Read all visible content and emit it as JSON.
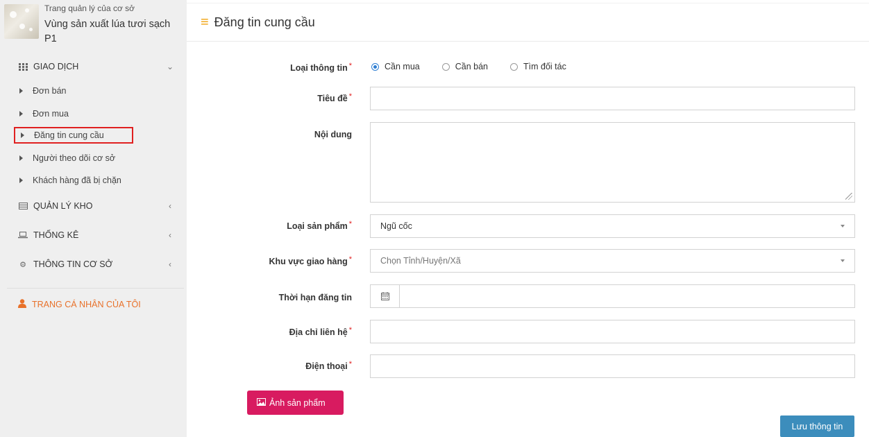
{
  "profile": {
    "subtitle": "Trang quản lý của cơ sở",
    "name": "Vùng sản xuất lúa tươi sạch P1"
  },
  "sidebar": {
    "transactions": {
      "label": "GIAO DỊCH",
      "icon": "grid-icon",
      "items": [
        {
          "label": "Đơn bán"
        },
        {
          "label": "Đơn mua"
        },
        {
          "label": "Đăng tin cung cầu"
        },
        {
          "label": "Người theo dõi cơ sở"
        },
        {
          "label": "Khách hàng đã bị chặn"
        }
      ]
    },
    "warehouse": {
      "label": "QUẢN LÝ KHO",
      "icon": "table-icon"
    },
    "stats": {
      "label": "THỐNG KÊ",
      "icon": "laptop-icon"
    },
    "info": {
      "label": "THÔNG TIN CƠ SỞ",
      "icon": "gears-icon"
    },
    "personal": {
      "label": "TRANG CÁ NHÂN CỦA TÔI",
      "icon": "user-icon",
      "color": "#e8712a"
    }
  },
  "header": {
    "title": "Đăng tin cung cầu",
    "icon": "bars-icon",
    "icon_color": "#f0a20c"
  },
  "form": {
    "info_type": {
      "label": "Loại thông tin",
      "required": "*",
      "options": [
        {
          "label": "Cần mua",
          "selected": true
        },
        {
          "label": "Cần bán",
          "selected": false
        },
        {
          "label": "Tìm đối tác",
          "selected": false
        }
      ]
    },
    "title": {
      "label": "Tiêu đề",
      "required": "*",
      "value": ""
    },
    "content": {
      "label": "Nội dung",
      "value": ""
    },
    "product_type": {
      "label": "Loại sản phẩm",
      "required": "*",
      "value": "Ngũ cốc"
    },
    "delivery_area": {
      "label": "Khu vực giao hàng",
      "required": "*",
      "placeholder": "Chọn Tỉnh/Huyện/Xã"
    },
    "duration": {
      "label": "Thời hạn đăng tin",
      "value": "",
      "icon": "calendar-icon"
    },
    "address": {
      "label": "Địa chỉ liên hệ",
      "required": "*",
      "value": ""
    },
    "phone": {
      "label": "Điện thoại",
      "required": "*",
      "value": ""
    }
  },
  "buttons": {
    "photo": {
      "label": "Ảnh sản phẩm",
      "icon": "image-icon",
      "color": "#d81b60"
    },
    "save": {
      "label": "Lưu thông tin",
      "color": "#3c8dbc"
    }
  },
  "accent": {
    "active_outline": "#e02020",
    "radio": "#2f7fd3"
  }
}
